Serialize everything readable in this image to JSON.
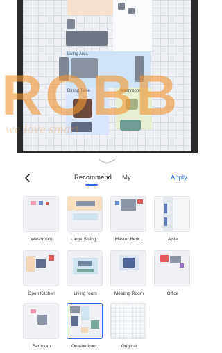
{
  "sheet": {
    "tabs": {
      "recommend": "Recommend",
      "my": "My"
    },
    "apply_label": "Apply",
    "back_icon": "chevron-left-icon",
    "handle_icon": "chevron-down-icon",
    "accent": "#2c6ef0"
  },
  "map": {
    "room_labels": {
      "living": "Living Area",
      "dining": "Dining Table",
      "washroom": "Washroom"
    }
  },
  "watermark": {
    "text": "ROBB",
    "tagline": "we love smart"
  },
  "templates": [
    {
      "label": "Washroom",
      "selected": false
    },
    {
      "label": "Large Sitting...",
      "selected": false
    },
    {
      "label": "Master Bedr...",
      "selected": false
    },
    {
      "label": "Aisle",
      "selected": false
    },
    {
      "label": "Open Kitchen",
      "selected": false
    },
    {
      "label": "Living room",
      "selected": false
    },
    {
      "label": "Meeting Room",
      "selected": false
    },
    {
      "label": "Office",
      "selected": false
    },
    {
      "label": "Bedroom",
      "selected": false
    },
    {
      "label": "One-bedroo...",
      "selected": true
    },
    {
      "label": "Original",
      "selected": false
    }
  ]
}
